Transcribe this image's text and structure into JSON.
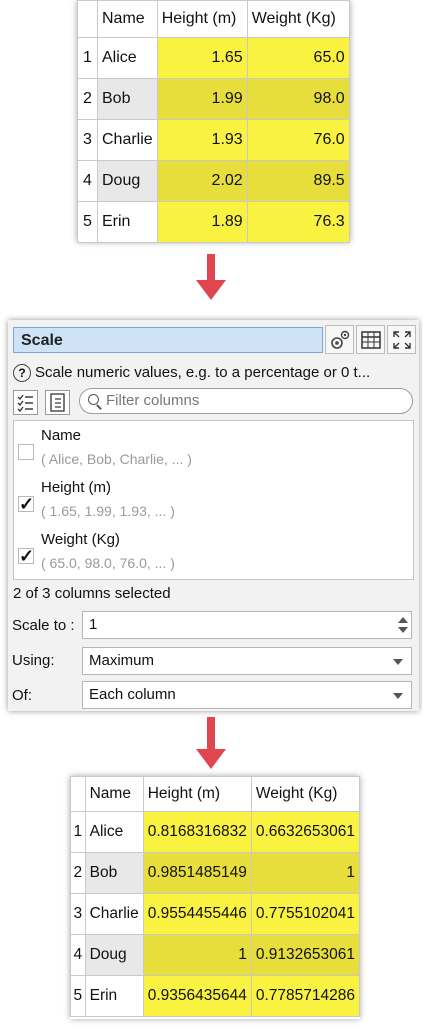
{
  "input_table": {
    "headers": [
      "",
      "Name",
      "Height (m)",
      "Weight (Kg)"
    ],
    "rows": [
      {
        "num": "1",
        "name": "Alice",
        "height": "1.65",
        "weight": "65.0"
      },
      {
        "num": "2",
        "name": "Bob",
        "height": "1.99",
        "weight": "98.0"
      },
      {
        "num": "3",
        "name": "Charlie",
        "height": "1.93",
        "weight": "76.0"
      },
      {
        "num": "4",
        "name": "Doug",
        "height": "2.02",
        "weight": "89.5"
      },
      {
        "num": "5",
        "name": "Erin",
        "height": "1.89",
        "weight": "76.3"
      }
    ]
  },
  "panel": {
    "title": "Scale",
    "description": "Scale numeric values, e.g. to a percentage or 0 t...",
    "filter_placeholder": "Filter columns",
    "columns": [
      {
        "name": "Name",
        "sample": "( Alice, Bob, Charlie, ... )",
        "checked": false
      },
      {
        "name": "Height (m)",
        "sample": "( 1.65, 1.99, 1.93, ... )",
        "checked": true
      },
      {
        "name": "Weight (Kg)",
        "sample": "( 65.0, 98.0, 76.0, ... )",
        "checked": true
      }
    ],
    "selected_count": "2 of 3 columns selected",
    "scale_to_label": "Scale to :",
    "scale_to_value": "1",
    "using_label": "Using:",
    "using_value": "Maximum",
    "of_label": "Of:",
    "of_value": "Each column",
    "check_mark": "✓",
    "help_glyph": "?"
  },
  "output_table": {
    "headers": [
      "",
      "Name",
      "Height (m)",
      "Weight (Kg)"
    ],
    "rows": [
      {
        "num": "1",
        "name": "Alice",
        "height": "0.8168316832",
        "weight": "0.6632653061"
      },
      {
        "num": "2",
        "name": "Bob",
        "height": "0.9851485149",
        "weight": "1"
      },
      {
        "num": "3",
        "name": "Charlie",
        "height": "0.9554455446",
        "weight": "0.7755102041"
      },
      {
        "num": "4",
        "name": "Doug",
        "height": "1",
        "weight": "0.9132653061"
      },
      {
        "num": "5",
        "name": "Erin",
        "height": "0.9356435644",
        "weight": "0.7785714286"
      }
    ]
  },
  "colors": {
    "highlight": "#f9f240",
    "highlight_alt": "#e7de3c",
    "arrow": "#e0464e",
    "title_bar": "#cfe3f7"
  }
}
